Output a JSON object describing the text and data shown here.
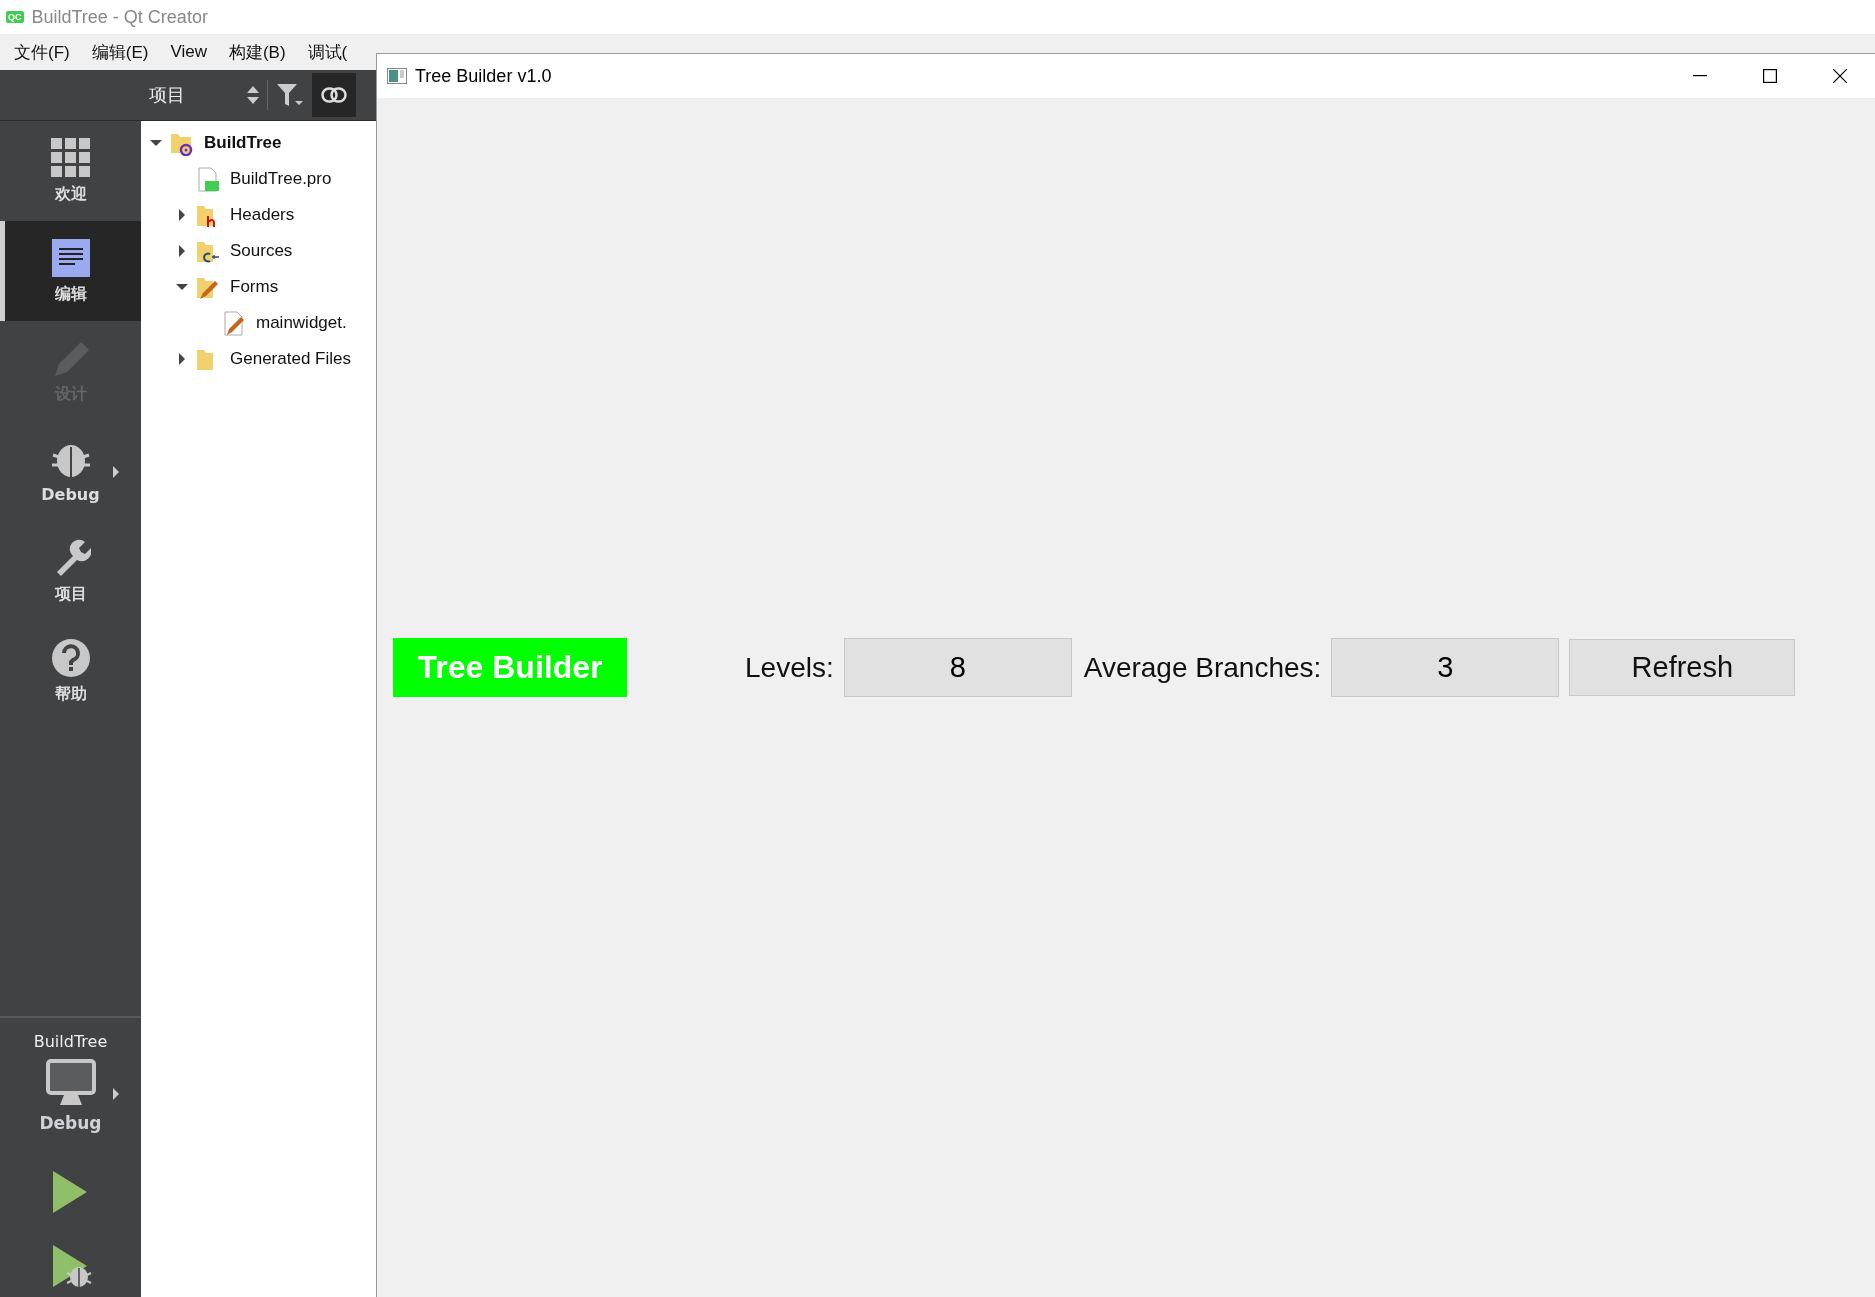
{
  "title_bar": {
    "app_badge": "QC",
    "title": "BuildTree - Qt Creator"
  },
  "menu": [
    {
      "label": "文件(F)"
    },
    {
      "label": "编辑(E)"
    },
    {
      "label": "View"
    },
    {
      "label": "构建(B)"
    },
    {
      "label": "调试("
    }
  ],
  "modes": [
    {
      "kind": "welcome",
      "label": "欢迎",
      "selected": false,
      "disabled": false,
      "has_menu": false
    },
    {
      "kind": "edit",
      "label": "编辑",
      "selected": true,
      "disabled": false,
      "has_menu": false
    },
    {
      "kind": "design",
      "label": "设计",
      "selected": false,
      "disabled": true,
      "has_menu": false
    },
    {
      "kind": "debug",
      "label": "Debug",
      "selected": false,
      "disabled": false,
      "has_menu": true
    },
    {
      "kind": "projects",
      "label": "项目",
      "selected": false,
      "disabled": false,
      "has_menu": false
    },
    {
      "kind": "help",
      "label": "帮助",
      "selected": false,
      "disabled": false,
      "has_menu": false
    }
  ],
  "kit": {
    "project": "BuildTree",
    "build": "Debug"
  },
  "project_panel": {
    "view": "项目",
    "sync_selected": true,
    "tree": [
      {
        "kind": "project",
        "label": "BuildTree",
        "expanded": true,
        "children": [
          {
            "kind": "pro",
            "label": "BuildTree.pro"
          },
          {
            "kind": "headers",
            "label": "Headers",
            "expanded": false
          },
          {
            "kind": "sources",
            "label": "Sources",
            "expanded": false
          },
          {
            "kind": "forms",
            "label": "Forms",
            "expanded": true,
            "children": [
              {
                "kind": "ui",
                "label": "mainwidget."
              }
            ]
          },
          {
            "kind": "folder",
            "label": "Generated Files",
            "expanded": false
          }
        ]
      }
    ]
  },
  "app_window": {
    "title": "Tree Builder v1.0",
    "heading": "Tree Builder",
    "levels_label": "Levels:",
    "levels_value": "8",
    "branches_label": "Average Branches:",
    "branches_value": "3",
    "refresh_button": "Refresh"
  }
}
